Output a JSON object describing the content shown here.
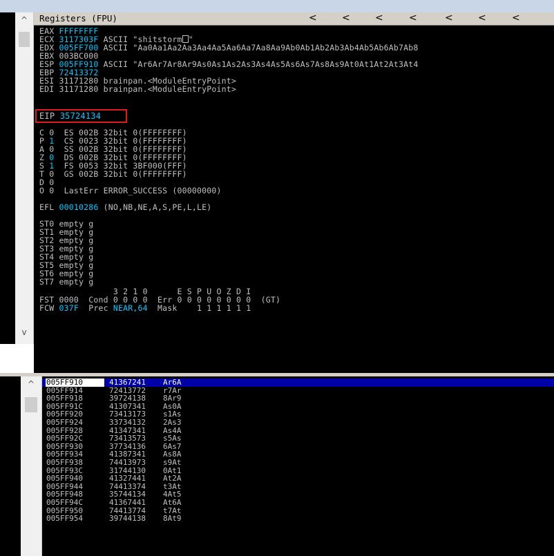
{
  "titlebar": {
    "title": "Registers (FPU)",
    "chevrons": [
      "<",
      "<",
      "<",
      "<",
      "<",
      "<",
      "<"
    ]
  },
  "scroll": {
    "up": "^",
    "down": "v"
  },
  "registers": [
    {
      "name": "EAX",
      "value": "FFFFFFFF",
      "info": ""
    },
    {
      "name": "ECX",
      "value": "3117303F",
      "info": "ASCII \"shitstorm",
      "info_tail": "\""
    },
    {
      "name": "EDX",
      "value": "005FF700",
      "info": "ASCII \"Aa0Aa1Aa2Aa3Aa4Aa5Aa6Aa7Aa8Aa9Ab0Ab1Ab2Ab3Ab4Ab5Ab6Ab7Ab8"
    },
    {
      "name": "EBX",
      "value": "003BC000",
      "info": ""
    },
    {
      "name": "ESP",
      "value": "005FF910",
      "info": "ASCII \"Ar6Ar7Ar8Ar9As0As1As2As3As4As5As6As7As8As9At0At1At2At3At4"
    },
    {
      "name": "EBP",
      "value": "72413372",
      "info": ""
    },
    {
      "name": "ESI",
      "value": "31171280",
      "info": "brainpan.<ModuleEntryPoint>"
    },
    {
      "name": "EDI",
      "value": "31171280",
      "info": "brainpan.<ModuleEntryPoint>"
    }
  ],
  "eip": {
    "name": "EIP",
    "value": "35724134"
  },
  "flags": [
    {
      "flag": "C",
      "bit": "0",
      "seg": "ES",
      "sel": "002B",
      "bits": "32bit",
      "desc": "0(FFFFFFFF)"
    },
    {
      "flag": "P",
      "bit": "1",
      "seg": "CS",
      "sel": "0023",
      "bits": "32bit",
      "desc": "0(FFFFFFFF)"
    },
    {
      "flag": "A",
      "bit": "0",
      "seg": "SS",
      "sel": "002B",
      "bits": "32bit",
      "desc": "0(FFFFFFFF)"
    },
    {
      "flag": "Z",
      "bit": "0",
      "seg": "DS",
      "sel": "002B",
      "bits": "32bit",
      "desc": "0(FFFFFFFF)"
    },
    {
      "flag": "S",
      "bit": "1",
      "seg": "FS",
      "sel": "0053",
      "bits": "32bit",
      "desc": "3BF000(FFF)"
    },
    {
      "flag": "T",
      "bit": "0",
      "seg": "GS",
      "sel": "002B",
      "bits": "32bit",
      "desc": "0(FFFFFFFF)"
    },
    {
      "flag": "D",
      "bit": "0",
      "seg": "",
      "sel": "",
      "bits": "",
      "desc": ""
    },
    {
      "flag": "O",
      "bit": "0",
      "seg": "LastErr",
      "sel": "ERROR_SUCCESS",
      "bits": "",
      "desc": "(00000000)"
    }
  ],
  "efl": {
    "name": "EFL",
    "value": "00010286",
    "desc": "(NO,NB,NE,A,S,PE,L,LE)"
  },
  "fpu": [
    {
      "name": "ST0",
      "state": "empty",
      "val": "g"
    },
    {
      "name": "ST1",
      "state": "empty",
      "val": "g"
    },
    {
      "name": "ST2",
      "state": "empty",
      "val": "g"
    },
    {
      "name": "ST3",
      "state": "empty",
      "val": "g"
    },
    {
      "name": "ST4",
      "state": "empty",
      "val": "g"
    },
    {
      "name": "ST5",
      "state": "empty",
      "val": "g"
    },
    {
      "name": "ST6",
      "state": "empty",
      "val": "g"
    },
    {
      "name": "ST7",
      "state": "empty",
      "val": "g"
    }
  ],
  "fpu_header": "               3 2 1 0      E S P U O Z D I",
  "fst": {
    "name": "FST",
    "value": "0000",
    "rest": "Cond 0 0 0 0  Err 0 0 0 0 0 0 0 0  (GT)"
  },
  "fcw": {
    "name": "FCW",
    "value": "037F",
    "prec_label": "Prec",
    "prec": "NEAR,64",
    "mask": "Mask    1 1 1 1 1 1"
  },
  "stack": [
    {
      "addr": "005FF910",
      "val": "41367241",
      "asc": "Ar6A"
    },
    {
      "addr": "005FF914",
      "val": "72413772",
      "asc": "r7Ar"
    },
    {
      "addr": "005FF918",
      "val": "39724138",
      "asc": "8Ar9"
    },
    {
      "addr": "005FF91C",
      "val": "41307341",
      "asc": "As0A"
    },
    {
      "addr": "005FF920",
      "val": "73413173",
      "asc": "s1As"
    },
    {
      "addr": "005FF924",
      "val": "33734132",
      "asc": "2As3"
    },
    {
      "addr": "005FF928",
      "val": "41347341",
      "asc": "As4A"
    },
    {
      "addr": "005FF92C",
      "val": "73413573",
      "asc": "s5As"
    },
    {
      "addr": "005FF930",
      "val": "37734136",
      "asc": "6As7"
    },
    {
      "addr": "005FF934",
      "val": "41387341",
      "asc": "As8A"
    },
    {
      "addr": "005FF938",
      "val": "74413973",
      "asc": "s9At"
    },
    {
      "addr": "005FF93C",
      "val": "31744130",
      "asc": "0At1"
    },
    {
      "addr": "005FF940",
      "val": "41327441",
      "asc": "At2A"
    },
    {
      "addr": "005FF944",
      "val": "74413374",
      "asc": "t3At"
    },
    {
      "addr": "005FF948",
      "val": "35744134",
      "asc": "4At5"
    },
    {
      "addr": "005FF94C",
      "val": "41367441",
      "asc": "At6A"
    },
    {
      "addr": "005FF950",
      "val": "74413774",
      "asc": "t7At"
    },
    {
      "addr": "005FF954",
      "val": "39744138",
      "asc": "8At9"
    }
  ]
}
